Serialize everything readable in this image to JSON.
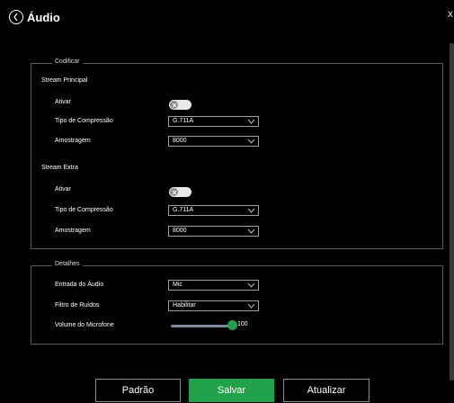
{
  "header": {
    "title": "Áudio",
    "close": "x"
  },
  "encode_group": {
    "legend": "Codificar",
    "main_stream": {
      "title": "Stream Principal",
      "enable_label": "Ativar",
      "compression_label": "Tipo de Compressão",
      "compression_value": "G.711A",
      "sampling_label": "Amostragem",
      "sampling_value": "8000"
    },
    "extra_stream": {
      "title": "Stream Extra",
      "enable_label": "Ativar",
      "compression_label": "Tipo de Compressão",
      "compression_value": "G.711A",
      "sampling_label": "Amostragem",
      "sampling_value": "8000"
    }
  },
  "details_group": {
    "legend": "Detalhes",
    "audio_input_label": "Entrada do Áudio",
    "audio_input_value": "Mic",
    "noise_filter_label": "Filtro de Ruídos",
    "noise_filter_value": "Habilitar",
    "mic_volume_label": "Volume do Microfone",
    "mic_volume_value": "100"
  },
  "buttons": {
    "default": "Padrão",
    "save": "Salvar",
    "refresh": "Atualizar"
  },
  "colors": {
    "accent": "#21a24a",
    "background": "#000000",
    "border": "#5a5a5a"
  },
  "icons": {
    "back": "chevron-left-circle-icon",
    "toggle_off": "x-icon",
    "select": "chevron-down-icon"
  }
}
